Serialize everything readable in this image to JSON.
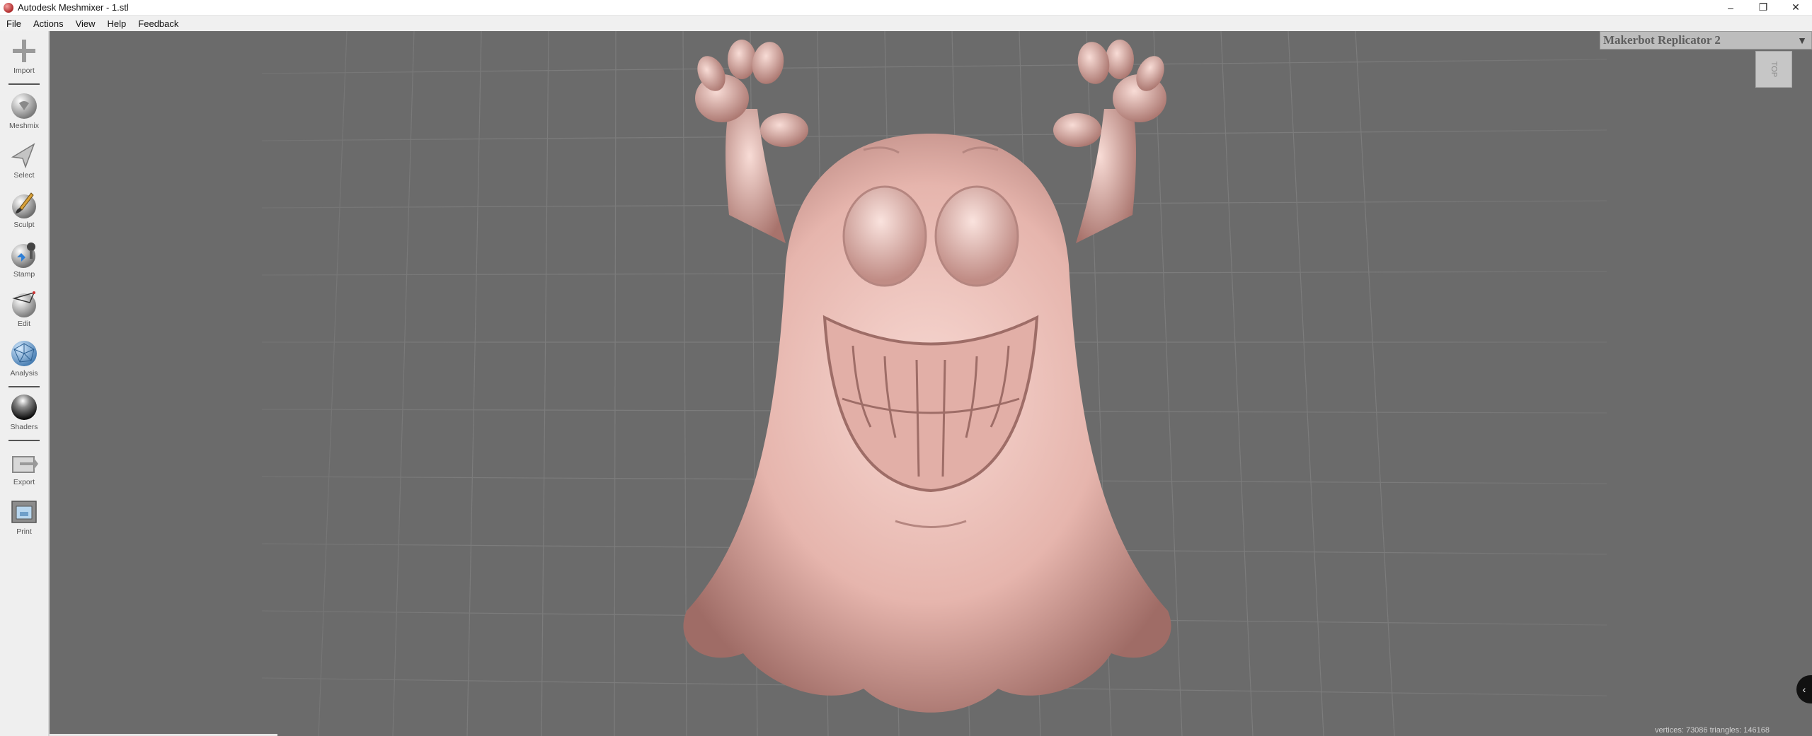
{
  "window": {
    "title": "Autodesk Meshmixer - 1.stl",
    "controls": {
      "minimize": "–",
      "restore": "❐",
      "close": "✕"
    }
  },
  "menu": [
    "File",
    "Actions",
    "View",
    "Help",
    "Feedback"
  ],
  "toolbar": [
    {
      "label": "Import",
      "icon": "plus-icon"
    },
    {
      "label": "Meshmix",
      "icon": "meshmix-icon"
    },
    {
      "label": "Select",
      "icon": "arrow-cursor-icon"
    },
    {
      "label": "Sculpt",
      "icon": "brush-icon"
    },
    {
      "label": "Stamp",
      "icon": "stamp-icon"
    },
    {
      "label": "Edit",
      "icon": "edit-sphere-icon"
    },
    {
      "label": "Analysis",
      "icon": "analysis-sphere-icon"
    },
    {
      "label": "Shaders",
      "icon": "shader-sphere-icon"
    },
    {
      "label": "Export",
      "icon": "export-icon"
    },
    {
      "label": "Print",
      "icon": "print-icon"
    }
  ],
  "printer": {
    "selected": "Makerbot Replicator 2",
    "arrow": "▼"
  },
  "viewcube": {
    "face": "TOP"
  },
  "status": {
    "text": "vertices: 73086 triangles: 146168"
  },
  "colors": {
    "viewport": "#6b6b6b",
    "model": "#e8b8b0",
    "toolbar": "#efefef"
  }
}
